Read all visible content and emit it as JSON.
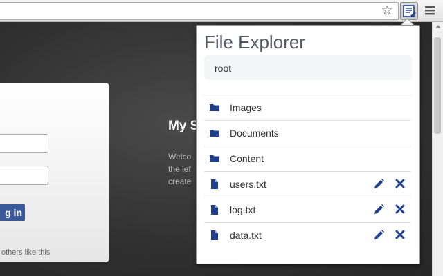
{
  "browser": {
    "star_icon": "star-icon",
    "extension_icon": "file-explorer-extension-icon",
    "menu_icon": "hamburger-menu-icon"
  },
  "background_page": {
    "login_button": "g in",
    "others_text": "others like this",
    "heading": "My S",
    "welcome_lines": "Welco\nthe lef\ncreate"
  },
  "popup": {
    "title": "File Explorer",
    "path": "root",
    "items": [
      {
        "label": "Images",
        "kind": "folder"
      },
      {
        "label": "Documents",
        "kind": "folder"
      },
      {
        "label": "Content",
        "kind": "folder"
      },
      {
        "label": "users.txt",
        "kind": "file"
      },
      {
        "label": "log.txt",
        "kind": "file"
      },
      {
        "label": "data.txt",
        "kind": "file"
      }
    ],
    "colors": {
      "icon": "#1f3f8c",
      "title": "#555b66"
    }
  }
}
